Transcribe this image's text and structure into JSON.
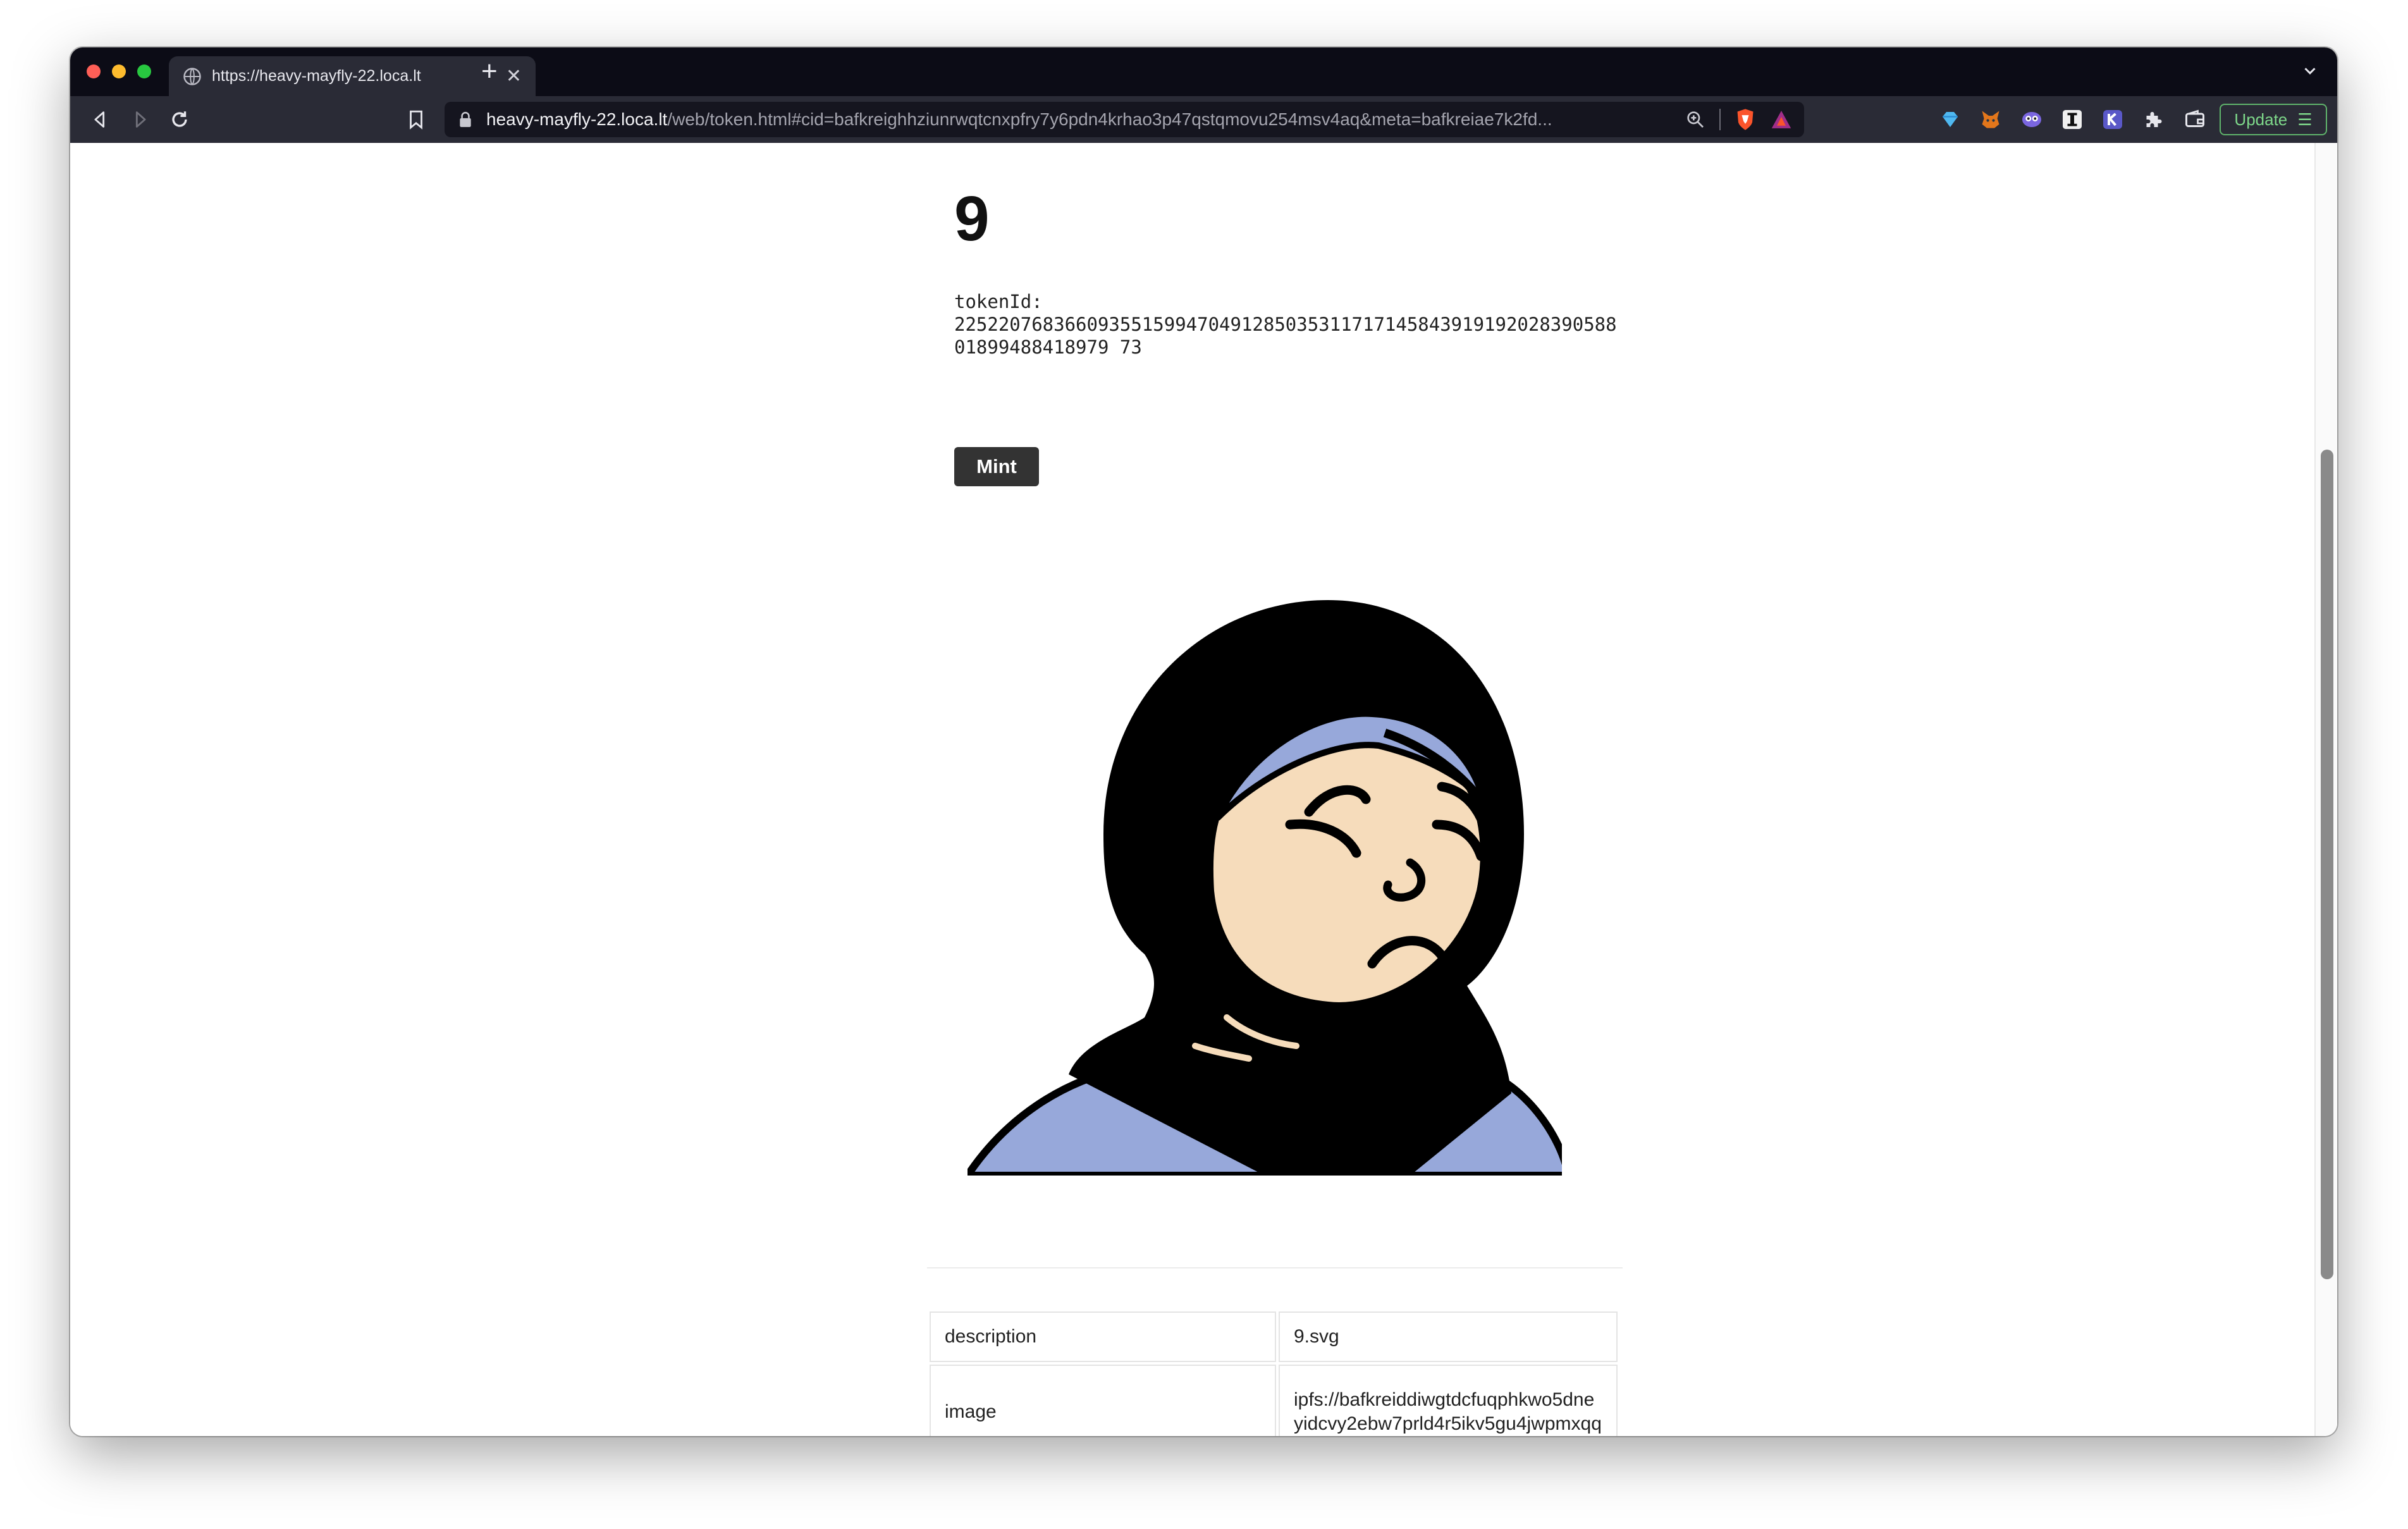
{
  "browser": {
    "tab": {
      "title": "https://heavy-mayfly-22.loca.lt",
      "close_glyph": "✕"
    },
    "new_tab_glyph": "+",
    "url": {
      "host": "heavy-mayfly-22.loca.lt",
      "path": "/web/token.html#cid=bafkreighhziunrwqtcnxpfry7y6pdn4krhao3p47qstqmovu254msv4aq&meta=bafkreiae7k2fd..."
    },
    "update_button": {
      "label": "Update",
      "menu_glyph": "☰"
    },
    "extensions": [
      "diamond-extension-icon",
      "metamask-fox-icon",
      "owl-extension-icon",
      "i-extension-icon",
      "k-extension-icon",
      "puzzle-icon",
      "wallet-icon"
    ],
    "colors": {
      "update_accent": "#5fb36b",
      "chrome_dark": "#0c0c16",
      "toolbar": "#2a2b36"
    }
  },
  "page": {
    "title": "9",
    "token_id_label": "tokenId:",
    "token_id_value": "22522076836609355159947049128503531171714584391919202839058801899488418979 73",
    "mint_label": "Mint",
    "metadata": [
      {
        "key": "description",
        "value": "9.svg"
      },
      {
        "key": "image",
        "value": "ipfs://bafkreiddiwgtdcfuqphkwo5dneyidcvy2ebw7prld4r5ikv5gu4jwpmxqq"
      }
    ],
    "colors": {
      "button": "#333333",
      "scarf": "#000000",
      "skin": "#f6dcbb",
      "accent_blue": "#97a8da"
    }
  }
}
